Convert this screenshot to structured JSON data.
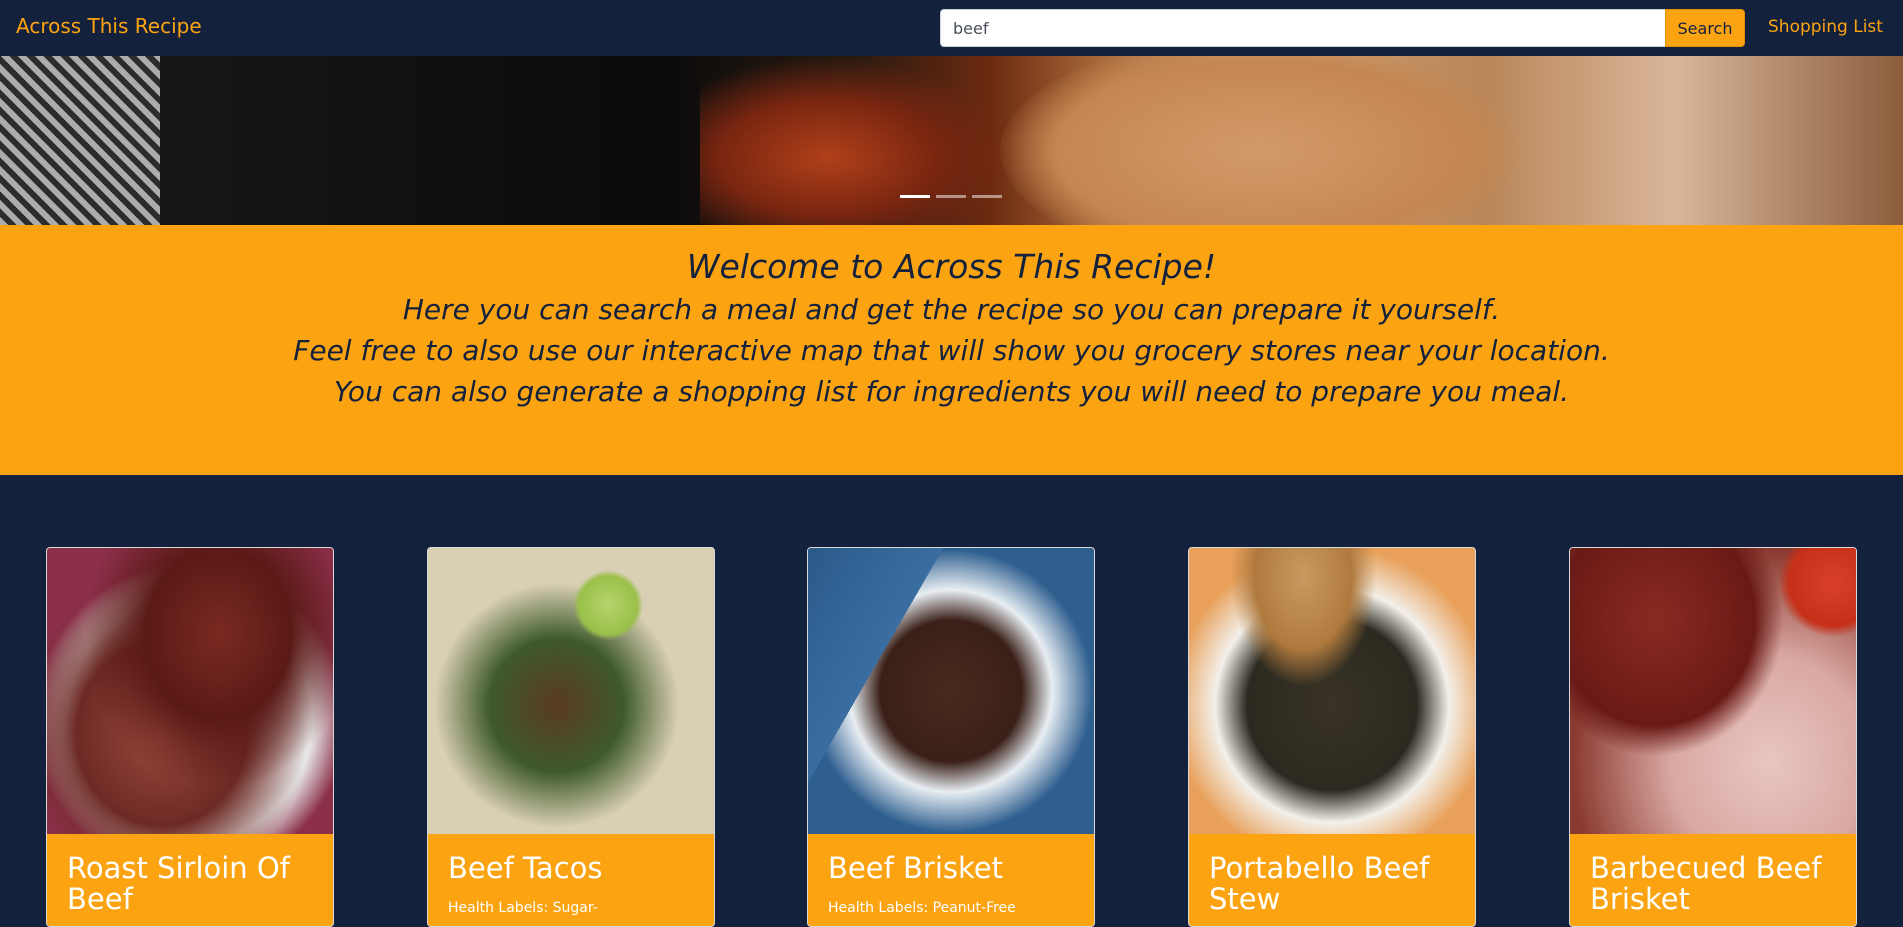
{
  "navbar": {
    "brand": "Across This Recipe",
    "search_value": "beef",
    "search_button": "Search",
    "shopping_list_link": "Shopping List"
  },
  "carousel": {
    "indicators": 3,
    "active_index": 0
  },
  "welcome": {
    "title": "Welcome to Across This Recipe!",
    "line1": "Here you can search a meal and get the recipe so you can prepare it yourself.",
    "line2": "Feel free to also use our interactive map that will show you grocery stores near your location.",
    "line3": "You can also generate a shopping list for ingredients you will need to prepare you meal."
  },
  "recipes": [
    {
      "title": "Roast Sirloin Of Beef",
      "labels": ""
    },
    {
      "title": "Beef Tacos",
      "labels": "Health Labels: Sugar-"
    },
    {
      "title": "Beef Brisket",
      "labels": "Health Labels: Peanut-Free"
    },
    {
      "title": "Portabello Beef Stew",
      "labels": ""
    },
    {
      "title": "Barbecued Beef Brisket",
      "labels": ""
    }
  ],
  "colors": {
    "navy": "#13213d",
    "accent": "#fca311",
    "white": "#ffffff"
  }
}
